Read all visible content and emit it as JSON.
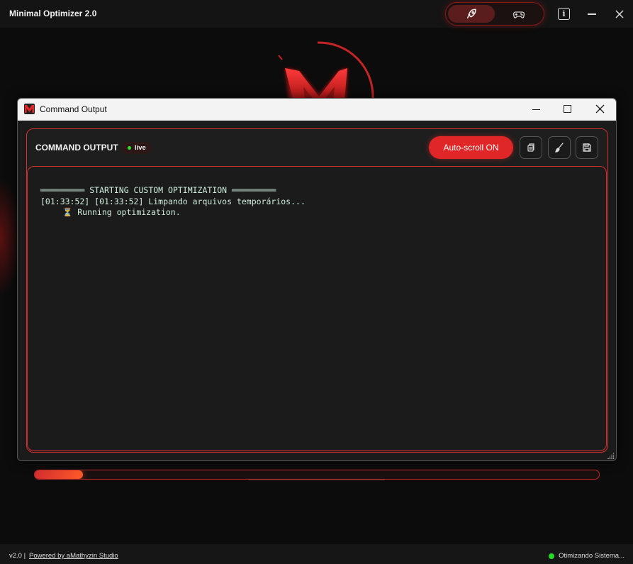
{
  "app": {
    "title": "Minimal Optimizer 2.0",
    "mode_icons": [
      "rocket-icon",
      "gamepad-icon"
    ],
    "info_label": "i",
    "accent": "#e02626"
  },
  "cmd_window": {
    "title": "Command Output",
    "header_label": "COMMAND OUTPUT",
    "live_label": "live",
    "autoscroll_label": "Auto-scroll ON",
    "tools": [
      "copy-icon",
      "brush-icon",
      "save-icon"
    ],
    "lines": [
      "═════════ STARTING CUSTOM OPTIMIZATION ═════════",
      "[01:33:52] [01:33:52] Limpando arquivos temporários...",
      "⏳ Running optimization."
    ]
  },
  "progress": {
    "fraction": 0.085
  },
  "footer": {
    "version": "v2.0 |",
    "link": "Powered by aMathyzin Studio",
    "status": "Otimizando Sistema..."
  }
}
